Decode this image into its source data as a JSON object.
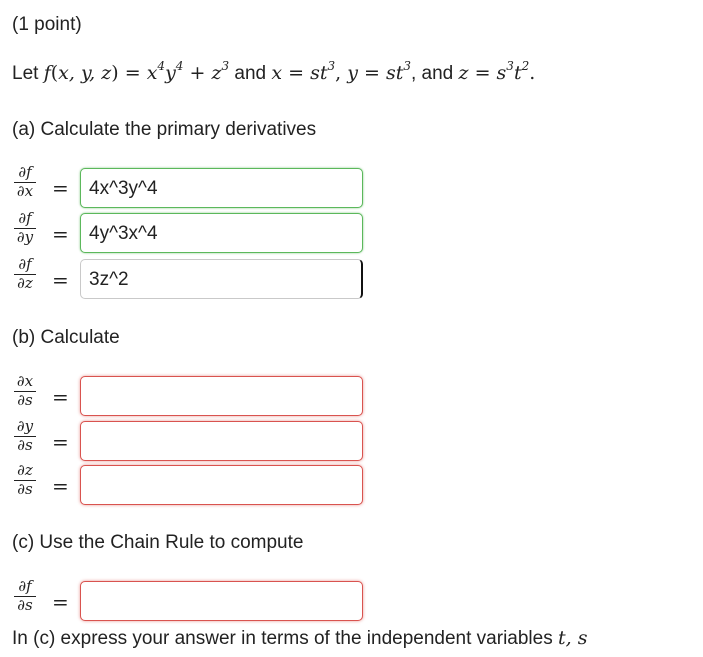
{
  "header": {
    "points": "(1 point)"
  },
  "problem": {
    "let": "Let",
    "and1": "and",
    "and2": "and"
  },
  "part_a": {
    "heading": "(a) Calculate the primary derivatives",
    "answers": [
      "4x^3y^4",
      "4y^3x^4",
      "3z^2"
    ]
  },
  "part_b": {
    "heading": "(b) Calculate",
    "answers": [
      "",
      "",
      ""
    ]
  },
  "part_c": {
    "heading": "(c) Use the Chain Rule to compute",
    "answer": "",
    "note": "In (c) express your answer in terms of the independent variables"
  },
  "colors": {
    "correct": "#5cb85c",
    "incorrect": "#d9534f"
  }
}
